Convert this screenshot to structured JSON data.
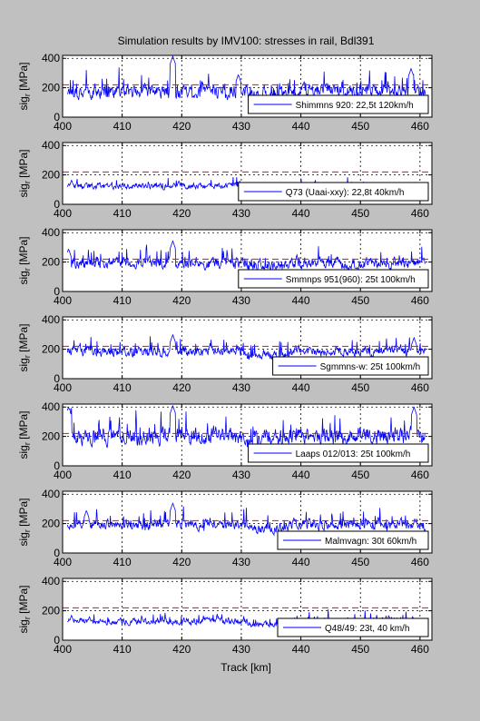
{
  "figure": {
    "title": "Simulation results by IMV100: stresses in rail, Bdl391",
    "xlabel": "Track [km]",
    "ylabel": "sig",
    "ylabel_sub": "r",
    "ylabel_unit": " [MPa]",
    "series_color": "#0000ff",
    "limit_color": "#ff0000"
  },
  "chart_data": [
    {
      "type": "line",
      "legend": "Shimmns 920: 22,5t 120km/h",
      "legend_position": "bottom-right",
      "xlim": [
        400,
        462
      ],
      "ylim": [
        0,
        420
      ],
      "xticks": [
        400,
        410,
        420,
        430,
        440,
        450,
        460
      ],
      "yticks": [
        0,
        200,
        400
      ],
      "limit_line": 220,
      "base": 175,
      "amplitude": 1.05,
      "peaks": [
        {
          "x": 418.5,
          "y": 415
        },
        {
          "x": 429.5,
          "y": 290
        },
        {
          "x": 458.5,
          "y": 330
        }
      ],
      "grid": true
    },
    {
      "type": "line",
      "legend": "Q73 (Uaai-xxy): 22,8t 40km/h",
      "legend_position": "bottom-right",
      "xlim": [
        400,
        462
      ],
      "ylim": [
        0,
        420
      ],
      "xticks": [
        400,
        410,
        420,
        430,
        440,
        450,
        460
      ],
      "yticks": [
        0,
        200,
        400
      ],
      "limit_line": 220,
      "base": 125,
      "amplitude": 0.45,
      "peaks": [
        {
          "x": 401.5,
          "y": 165
        },
        {
          "x": 419.5,
          "y": 160
        }
      ],
      "grid": true
    },
    {
      "type": "line",
      "legend": "Smmnps 951(960): 25t 100km/h",
      "legend_position": "bottom-right",
      "xlim": [
        400,
        462
      ],
      "ylim": [
        0,
        420
      ],
      "xticks": [
        400,
        410,
        420,
        430,
        440,
        450,
        460
      ],
      "yticks": [
        0,
        200,
        400
      ],
      "limit_line": 220,
      "base": 195,
      "amplitude": 0.85,
      "peaks": [
        {
          "x": 418.5,
          "y": 345
        },
        {
          "x": 401,
          "y": 290
        }
      ],
      "grid": true
    },
    {
      "type": "line",
      "legend": "Sgmmns-w: 25t 100km/h",
      "legend_position": "bottom-right",
      "xlim": [
        400,
        462
      ],
      "ylim": [
        0,
        420
      ],
      "xticks": [
        400,
        410,
        420,
        430,
        440,
        450,
        460
      ],
      "yticks": [
        0,
        200,
        400
      ],
      "limit_line": 220,
      "base": 185,
      "amplitude": 0.75,
      "peaks": [
        {
          "x": 418.5,
          "y": 300
        },
        {
          "x": 459,
          "y": 280
        }
      ],
      "grid": true
    },
    {
      "type": "line",
      "legend": "Laaps 012/013: 25t 100km/h",
      "legend_position": "bottom-right",
      "xlim": [
        400,
        462
      ],
      "ylim": [
        0,
        420
      ],
      "xticks": [
        400,
        410,
        420,
        430,
        440,
        450,
        460
      ],
      "yticks": [
        0,
        200,
        400
      ],
      "limit_line": 220,
      "base": 205,
      "amplitude": 1.35,
      "peaks": [
        {
          "x": 401,
          "y": 400
        },
        {
          "x": 418.5,
          "y": 410
        },
        {
          "x": 459,
          "y": 400
        }
      ],
      "grid": true
    },
    {
      "type": "line",
      "legend": "Malmvagn: 30t 60km/h",
      "legend_position": "bottom-right",
      "xlim": [
        400,
        462
      ],
      "ylim": [
        0,
        420
      ],
      "xticks": [
        400,
        410,
        420,
        430,
        440,
        450,
        460
      ],
      "yticks": [
        0,
        200,
        400
      ],
      "limit_line": 220,
      "base": 195,
      "amplitude": 0.8,
      "peaks": [
        {
          "x": 418.5,
          "y": 340
        },
        {
          "x": 404,
          "y": 290
        }
      ],
      "grid": true
    },
    {
      "type": "line",
      "legend": "Q48/49: 23t, 40 km/h",
      "legend_position": "bottom-right",
      "xlim": [
        400,
        462
      ],
      "ylim": [
        0,
        420
      ],
      "xticks": [
        400,
        410,
        420,
        430,
        440,
        450,
        460
      ],
      "yticks": [
        0,
        200,
        400
      ],
      "limit_line": 220,
      "base": 130,
      "amplitude": 0.5,
      "peaks": [
        {
          "x": 401.5,
          "y": 170
        },
        {
          "x": 404.5,
          "y": 160
        }
      ],
      "grid": true
    }
  ]
}
